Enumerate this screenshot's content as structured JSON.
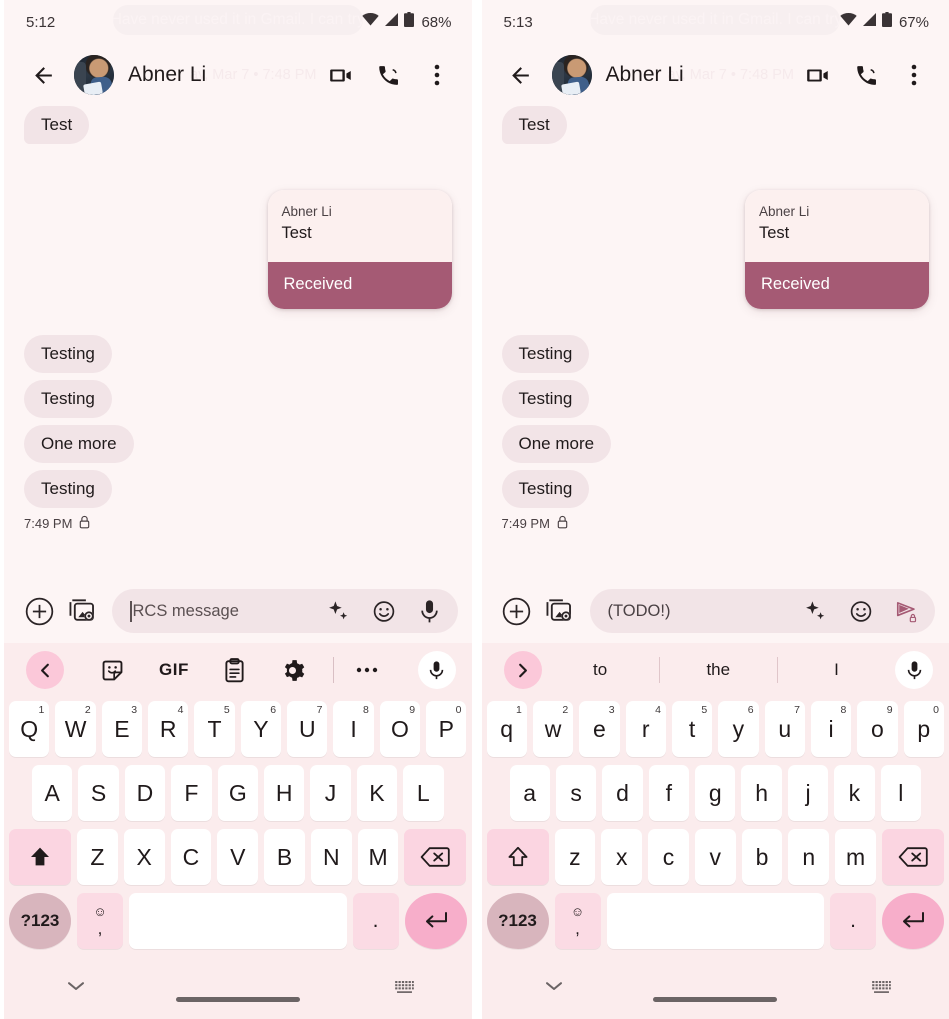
{
  "panels": [
    {
      "id": "left",
      "status": {
        "time": "5:12",
        "battery": "68%",
        "ghost_notification": "Have never used it in Gmail. I can try"
      },
      "appbar": {
        "contact": "Abner Li",
        "ghost_date": "ay, Mar 7 • 7:48 PM",
        "back": "back-arrow",
        "video": "video-call",
        "call": "phone-call",
        "more": "overflow-menu"
      },
      "thread": {
        "top_bubble": "Test",
        "card": {
          "sender": "Abner Li",
          "text": "Test",
          "footer": "Received"
        },
        "messages": [
          "Testing",
          "Testing",
          "One more",
          "Testing"
        ],
        "timestamp": "7:49 PM"
      },
      "composer": {
        "plus": "add-button",
        "gallery": "gallery-button",
        "value": "",
        "placeholder": "RCS message",
        "has_caret": true,
        "sparkle": "magic-compose",
        "emoji": "emoji",
        "trailing": "mic"
      },
      "keyboard": {
        "mode": "toolbar",
        "toolbar_arrow": "chevron-left",
        "tools": [
          "sticker",
          "GIF",
          "clipboard",
          "settings",
          "more"
        ],
        "mic": "mic",
        "suggestions": [],
        "rows": [
          [
            {
              "k": "Q",
              "n": "1"
            },
            {
              "k": "W",
              "n": "2"
            },
            {
              "k": "E",
              "n": "3"
            },
            {
              "k": "R",
              "n": "4"
            },
            {
              "k": "T",
              "n": "5"
            },
            {
              "k": "Y",
              "n": "6"
            },
            {
              "k": "U",
              "n": "7"
            },
            {
              "k": "I",
              "n": "8"
            },
            {
              "k": "O",
              "n": "9"
            },
            {
              "k": "P",
              "n": "0"
            }
          ],
          [
            {
              "k": "A"
            },
            {
              "k": "S"
            },
            {
              "k": "D"
            },
            {
              "k": "F"
            },
            {
              "k": "G"
            },
            {
              "k": "H"
            },
            {
              "k": "J"
            },
            {
              "k": "K"
            },
            {
              "k": "L"
            }
          ],
          [
            {
              "k": "Z"
            },
            {
              "k": "X"
            },
            {
              "k": "C"
            },
            {
              "k": "V"
            },
            {
              "k": "B"
            },
            {
              "k": "N"
            },
            {
              "k": "M"
            }
          ]
        ],
        "shift_state": "filled",
        "backspace": "backspace",
        "num_key": "?123",
        "comma_key": ",",
        "period_key": ".",
        "enter_key": "enter"
      },
      "navbar": {
        "chevron": "chevron-down",
        "keyboard_icon": "hide-keyboard",
        "handle": "gesture-handle"
      }
    },
    {
      "id": "right",
      "status": {
        "time": "5:13",
        "battery": "67%",
        "ghost_notification": "Have never used it in Gmail. I can try"
      },
      "appbar": {
        "contact": "Abner Li",
        "ghost_date": "ay, Mar 7 • 7:48 PM",
        "back": "back-arrow",
        "video": "video-call",
        "call": "phone-call",
        "more": "overflow-menu"
      },
      "thread": {
        "top_bubble": "Test",
        "card": {
          "sender": "Abner Li",
          "text": "Test",
          "footer": "Received"
        },
        "messages": [
          "Testing",
          "Testing",
          "One more",
          "Testing"
        ],
        "timestamp": "7:49 PM"
      },
      "composer": {
        "plus": "add-button",
        "gallery": "gallery-button",
        "value": "(TODO!)",
        "placeholder": "(TODO!)",
        "has_caret": false,
        "sparkle": "magic-compose",
        "emoji": "emoji",
        "trailing": "send-locked"
      },
      "keyboard": {
        "mode": "suggestions",
        "toolbar_arrow": "chevron-right",
        "tools": [],
        "mic": "mic",
        "suggestions": [
          "to",
          "the",
          "I"
        ],
        "rows": [
          [
            {
              "k": "q",
              "n": "1"
            },
            {
              "k": "w",
              "n": "2"
            },
            {
              "k": "e",
              "n": "3"
            },
            {
              "k": "r",
              "n": "4"
            },
            {
              "k": "t",
              "n": "5"
            },
            {
              "k": "y",
              "n": "6"
            },
            {
              "k": "u",
              "n": "7"
            },
            {
              "k": "i",
              "n": "8"
            },
            {
              "k": "o",
              "n": "9"
            },
            {
              "k": "p",
              "n": "0"
            }
          ],
          [
            {
              "k": "a"
            },
            {
              "k": "s"
            },
            {
              "k": "d"
            },
            {
              "k": "f"
            },
            {
              "k": "g"
            },
            {
              "k": "h"
            },
            {
              "k": "j"
            },
            {
              "k": "k"
            },
            {
              "k": "l"
            }
          ],
          [
            {
              "k": "z"
            },
            {
              "k": "x"
            },
            {
              "k": "c"
            },
            {
              "k": "v"
            },
            {
              "k": "b"
            },
            {
              "k": "n"
            },
            {
              "k": "m"
            }
          ]
        ],
        "shift_state": "outline",
        "backspace": "backspace",
        "num_key": "?123",
        "comma_key": ",",
        "period_key": ".",
        "enter_key": "enter"
      },
      "navbar": {
        "chevron": "chevron-down",
        "keyboard_icon": "hide-keyboard",
        "handle": "gesture-handle"
      }
    }
  ],
  "colors": {
    "background": "#fdf5f5",
    "bubble_in": "#f2e4e7",
    "card_footer": "#a55a74",
    "keyboard_bg": "#fbeced",
    "accent_pink": "#f7aeca",
    "mod_key": "#fbd5e1"
  }
}
